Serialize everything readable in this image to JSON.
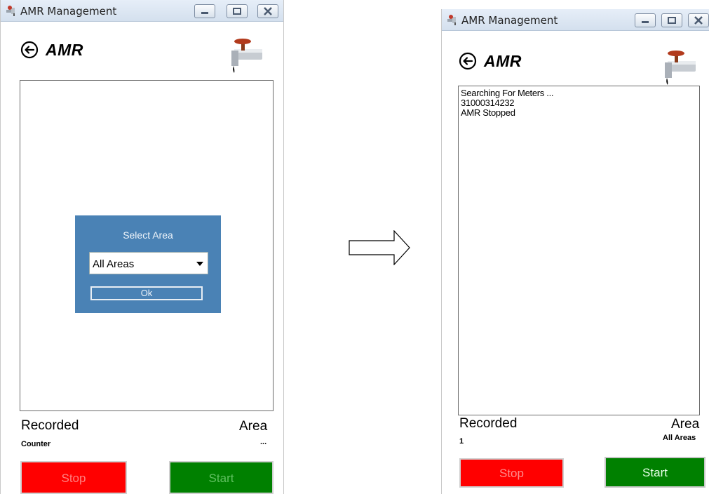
{
  "left_window": {
    "title": "AMR Management",
    "page_title": "AMR",
    "dialog": {
      "title": "Select Area",
      "selected_area": "All Areas",
      "ok_label": "Ok"
    },
    "recorded_label": "Recorded",
    "recorded_value": "Counter",
    "area_label": "Area",
    "area_value": "...",
    "stop_label": "Stop",
    "start_label": "Start"
  },
  "right_window": {
    "title": "AMR Management",
    "page_title": "AMR",
    "log_lines": [
      "Searching For Meters ...",
      "31000314232",
      "AMR Stopped"
    ],
    "recorded_label": "Recorded",
    "recorded_value": "1",
    "area_label": "Area",
    "area_value": "All Areas",
    "stop_label": "Stop",
    "start_label": "Start"
  },
  "icons": {
    "back": "back-arrow-circle-icon",
    "tap": "water-tap-icon",
    "window_app": "app-icon",
    "minimize": "minimize-icon",
    "maximize": "maximize-icon",
    "close": "close-icon",
    "transition_arrow": "right-arrow-icon"
  },
  "colors": {
    "dialog_bg": "#4a82b5",
    "stop_bg": "#ff0000",
    "start_bg": "#008000"
  }
}
